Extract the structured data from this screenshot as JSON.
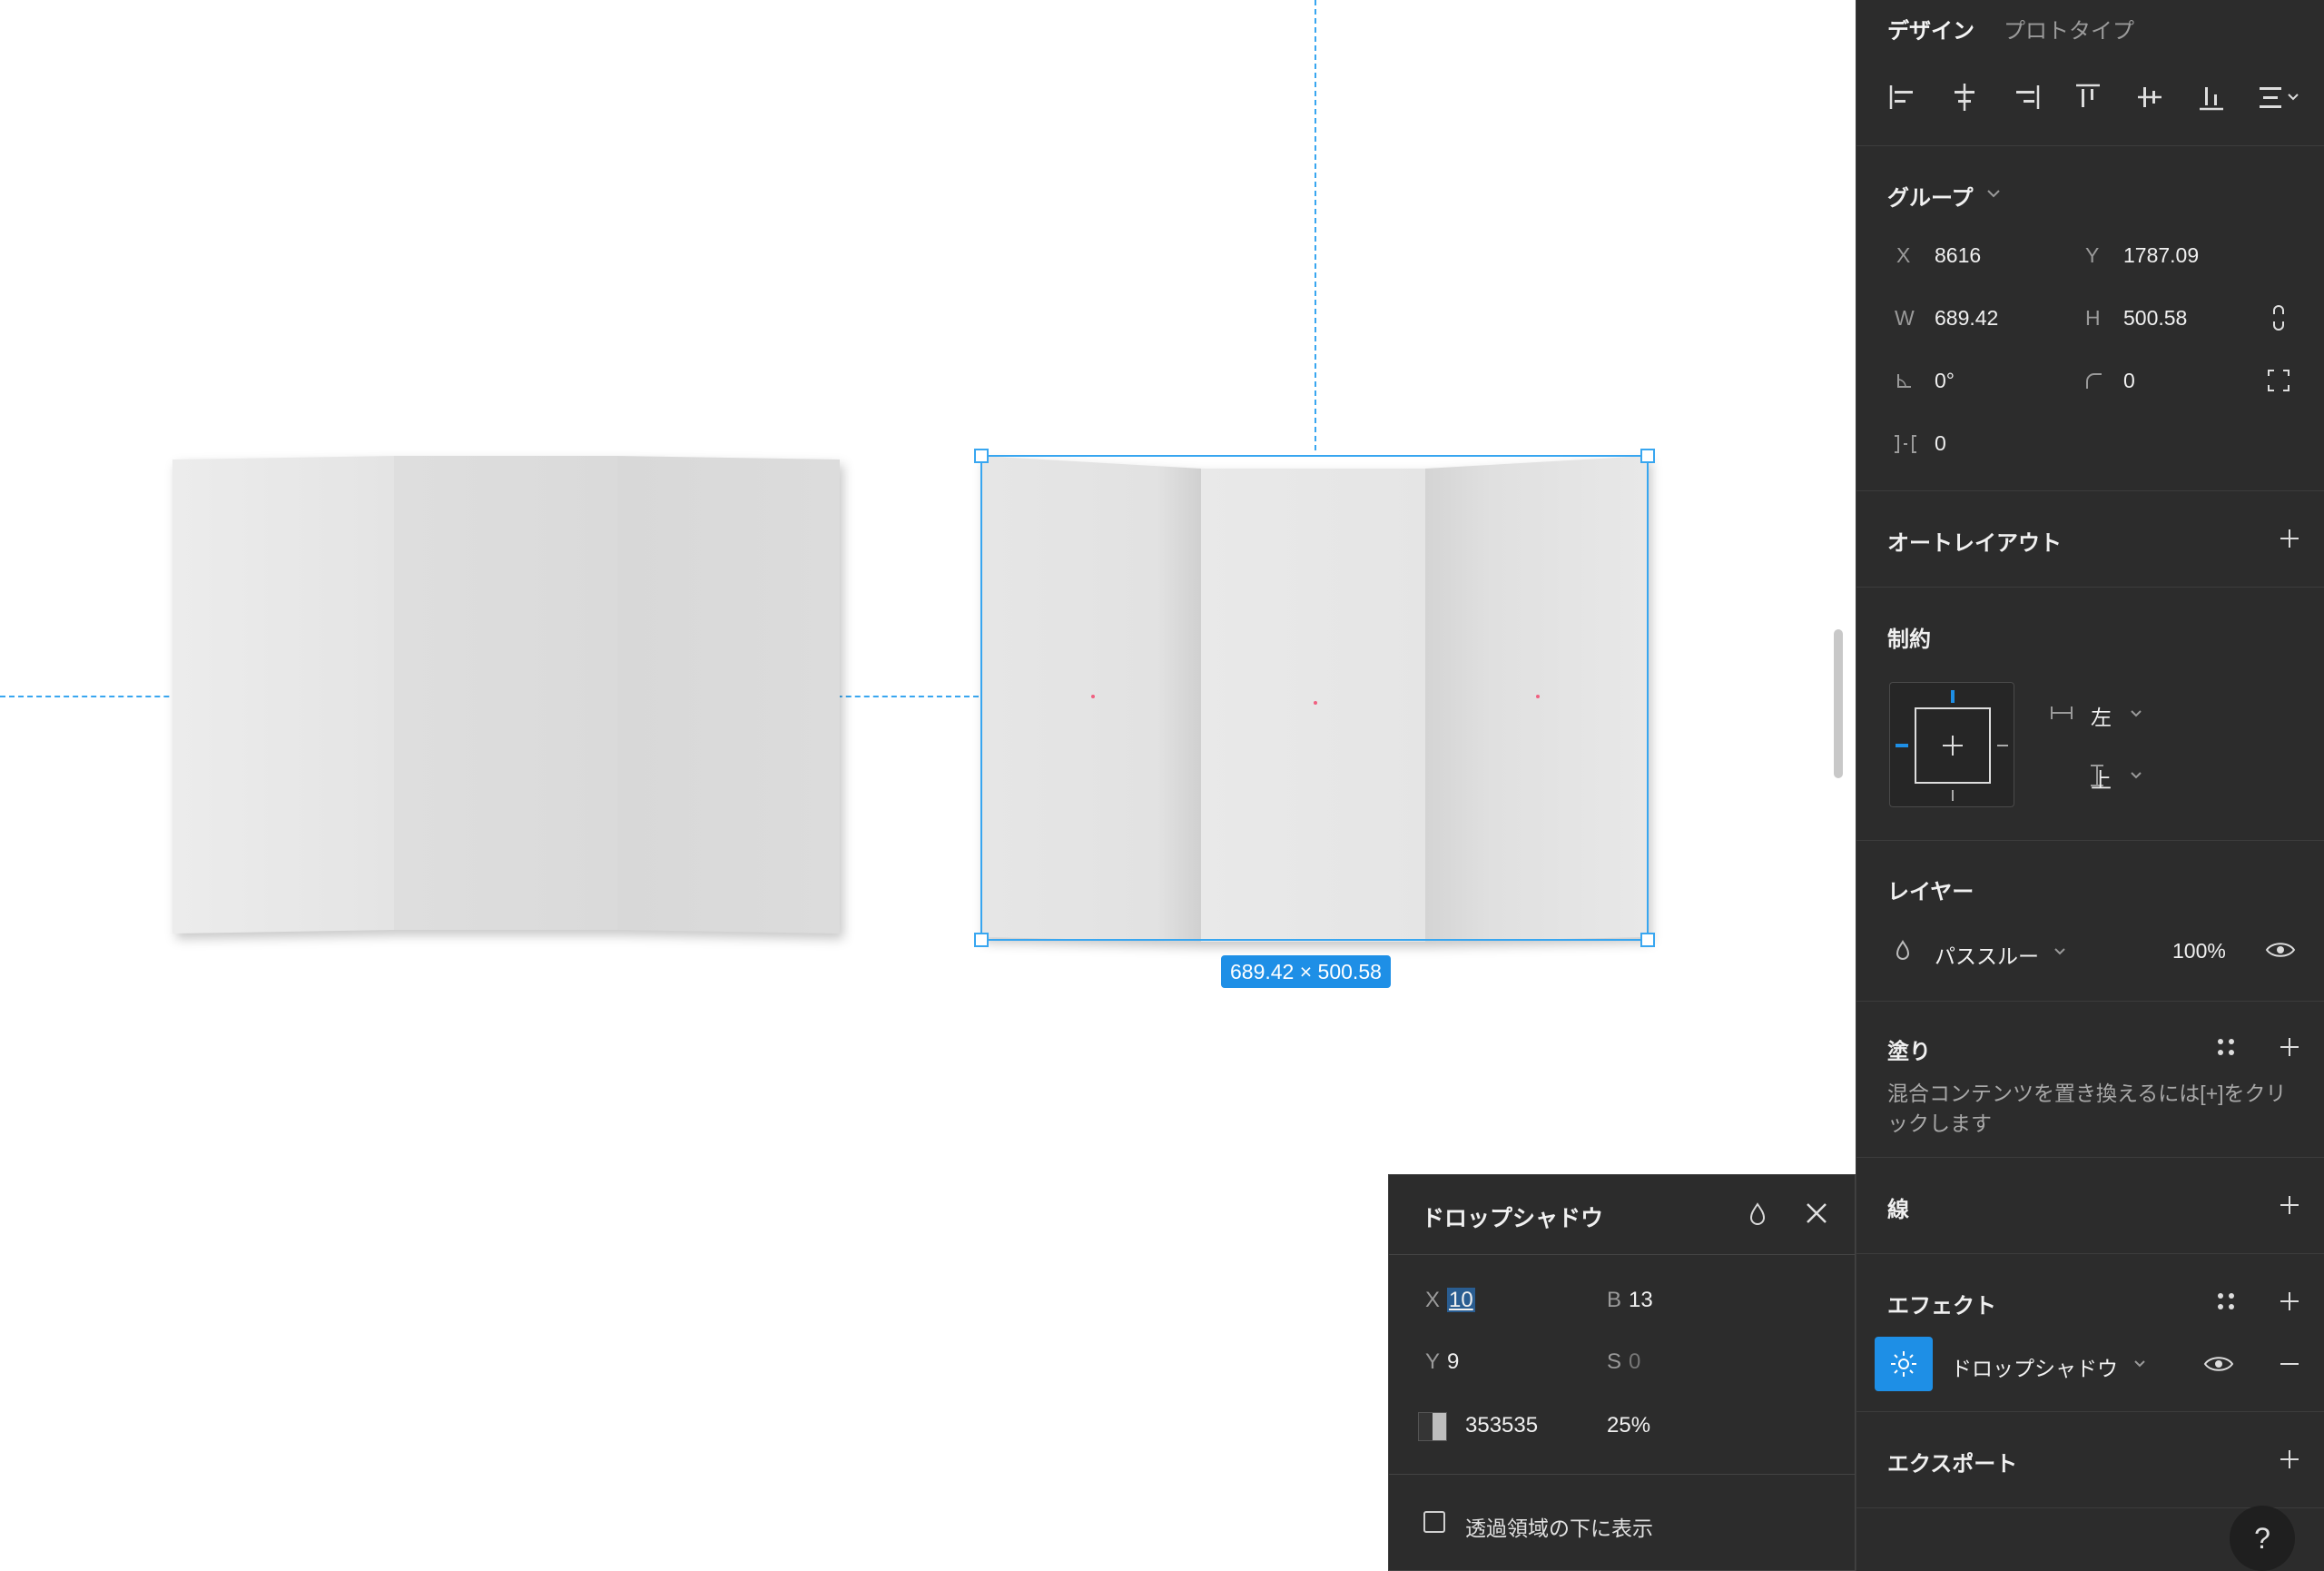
{
  "canvas": {
    "selection_size_label": "689.42 × 500.58"
  },
  "drop_shadow_popup": {
    "title": "ドロップシャドウ",
    "x_label": "X",
    "x_value": "10",
    "y_label": "Y",
    "y_value": "9",
    "blur_label": "B",
    "blur_value": "13",
    "spread_label": "S",
    "spread_value": "0",
    "color_hex": "353535",
    "opacity": "25%",
    "checkbox_label": "透過領域の下に表示"
  },
  "panel": {
    "tabs": {
      "design": "デザイン",
      "prototype": "プロトタイプ"
    },
    "group": {
      "title": "グループ",
      "x_label": "X",
      "x_value": "8616",
      "y_label": "Y",
      "y_value": "1787.09",
      "w_label": "W",
      "w_value": "689.42",
      "h_label": "H",
      "h_value": "500.58",
      "rotation": "0°",
      "radius": "0",
      "clip": "0"
    },
    "auto_layout": {
      "title": "オートレイアウト"
    },
    "constraints": {
      "title": "制約",
      "horizontal": "左",
      "vertical": "上"
    },
    "layer": {
      "title": "レイヤー",
      "blend": "パススルー",
      "opacity": "100%"
    },
    "fill": {
      "title": "塗り",
      "mixed_message": "混合コンテンツを置き換えるには[+]をクリックします"
    },
    "stroke": {
      "title": "線"
    },
    "effects": {
      "title": "エフェクト",
      "item": "ドロップシャドウ"
    },
    "export": {
      "title": "エクスポート"
    },
    "help": "?"
  },
  "colors": {
    "accent": "#1e8fe6",
    "panel_bg": "#2c2c2c",
    "guide": "#38a6f0"
  }
}
